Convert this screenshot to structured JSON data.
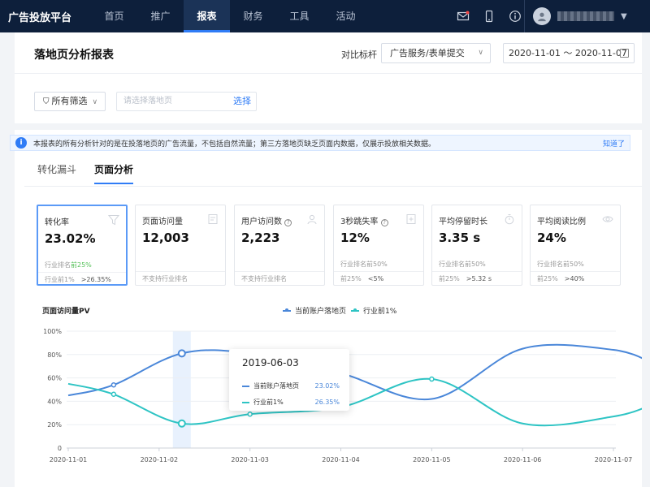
{
  "nav": {
    "brand": "广告投放平台",
    "items": [
      {
        "label": "首页",
        "active": false
      },
      {
        "label": "推广",
        "active": false
      },
      {
        "label": "报表",
        "active": true
      },
      {
        "label": "财务",
        "active": false
      },
      {
        "label": "工具",
        "active": false
      },
      {
        "label": "活动",
        "active": false
      }
    ],
    "icons": [
      "mail-icon",
      "phone-icon",
      "info-icon"
    ]
  },
  "header": {
    "title": "落地页分析报表",
    "compare_label": "对比标杆",
    "compare_value": "广告服务/表单提交",
    "date_range": "2020-11-01 ～ 2020-11-07",
    "filter_label": "所有筛选",
    "search_placeholder": "请选择落地页",
    "search_button": "选择"
  },
  "notice": {
    "text": "本报表的所有分析针对的是在投落地页的广告流量，不包括自然流量；第三方落地页缺乏页面内数据，仅展示投放相关数据。",
    "action": "知道了"
  },
  "tabs": [
    {
      "label": "转化漏斗",
      "active": false
    },
    {
      "label": "页面分析",
      "active": true
    }
  ],
  "metrics": [
    {
      "label": "转化率",
      "value": "23.02%",
      "rank_prefix": "行业排名",
      "rank_value": "前25%",
      "foot_label": "行业前1%",
      "foot_value": ">26.35%",
      "icon": "funnel-icon",
      "active": true
    },
    {
      "label": "页面访问量",
      "value": "12,003",
      "rank_prefix": "",
      "rank_value": "",
      "foot_label": "不支持行业排名",
      "foot_value": "",
      "icon": "document-icon",
      "active": false
    },
    {
      "label": "用户访问数",
      "value": "2,223",
      "rank_prefix": "",
      "rank_value": "",
      "foot_label": "不支持行业排名",
      "foot_value": "",
      "icon": "user-icon",
      "active": false
    },
    {
      "label": "3秒跳失率",
      "value": "12%",
      "rank_prefix": "行业排名",
      "rank_value": "前50%",
      "foot_label": "前25%",
      "foot_value": "<5%",
      "icon": "plus-box-icon",
      "active": false
    },
    {
      "label": "平均停留时长",
      "value": "3.35 s",
      "rank_prefix": "行业排名",
      "rank_value": "前50%",
      "foot_label": "前25%",
      "foot_value": ">5.32 s",
      "icon": "stopwatch-icon",
      "active": false
    },
    {
      "label": "平均阅读比例",
      "value": "24%",
      "rank_prefix": "行业排名",
      "rank_value": "前50%",
      "foot_label": "前25%",
      "foot_value": ">40%",
      "icon": "eye-icon",
      "active": false
    }
  ],
  "colors": {
    "accent": "#2f7cf6",
    "series1": "#4a87d9",
    "series2": "#2ec4c4"
  },
  "chart_data": {
    "type": "line",
    "title": "页面访问量PV",
    "x": [
      "2020-11-01",
      "2020-11-02",
      "2020-11-03",
      "2020-11-04",
      "2020-11-05",
      "2020-11-06",
      "2020-11-07"
    ],
    "x_points": [
      0,
      0.5,
      1.25,
      2.0,
      3.0,
      4.0,
      5.0,
      6.0,
      6.45
    ],
    "series": [
      {
        "name": "当前账户落地页",
        "y": [
          45,
          54,
          81,
          81,
          64,
          42,
          85,
          84,
          72
        ],
        "markers": [
          1,
          2
        ]
      },
      {
        "name": "行业前1%",
        "y": [
          55,
          46,
          21,
          29,
          35,
          59,
          21,
          27,
          38
        ],
        "markers": [
          1,
          2,
          3,
          5
        ]
      }
    ],
    "ylim": [
      0,
      100
    ],
    "yticks": [
      "0",
      "20%",
      "40%",
      "60%",
      "80%",
      "100%"
    ],
    "legend": "top",
    "tooltip": {
      "date": "2019-06-03",
      "rows": [
        {
          "name": "当前账户落地页",
          "value": "23.02%"
        },
        {
          "name": "行业前1%",
          "value": "26.35%"
        }
      ]
    }
  }
}
